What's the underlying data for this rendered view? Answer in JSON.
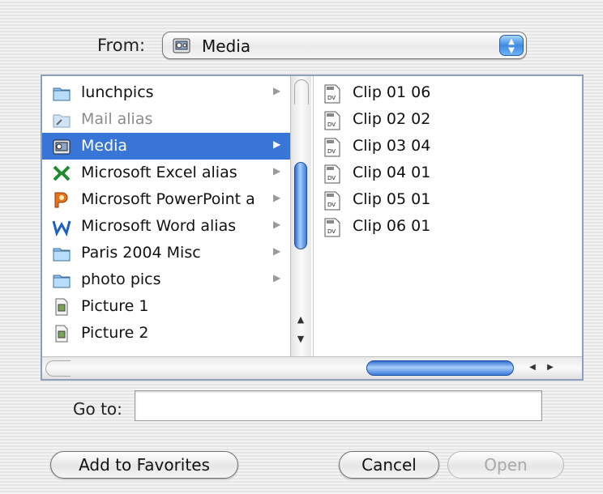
{
  "from": {
    "label": "From:",
    "selected": "Media",
    "icon": "media-folder-icon"
  },
  "left_column": {
    "items": [
      {
        "label": "lunchpics",
        "icon": "folder-icon",
        "arrow": "▶"
      },
      {
        "label": "Mail alias",
        "icon": "alias-icon",
        "dimmed": true
      },
      {
        "label": "Media",
        "icon": "media-folder-icon",
        "arrow": "▶",
        "selected": true
      },
      {
        "label": "Microsoft Excel alias",
        "icon": "excel-icon",
        "arrow": "▶"
      },
      {
        "label": "Microsoft PowerPoint a",
        "icon": "powerpoint-icon",
        "arrow": "▶"
      },
      {
        "label": "Microsoft Word alias",
        "icon": "word-icon",
        "arrow": "▶"
      },
      {
        "label": "Paris 2004 Misc",
        "icon": "folder-icon",
        "arrow": "▶"
      },
      {
        "label": "photo pics",
        "icon": "folder-icon",
        "arrow": "▶"
      },
      {
        "label": "Picture 1",
        "icon": "picture-file-icon"
      },
      {
        "label": "Picture 2",
        "icon": "picture-file-icon"
      }
    ]
  },
  "right_column": {
    "items": [
      {
        "label": "Clip 01 06",
        "icon": "dv-file-icon"
      },
      {
        "label": "Clip 02 02",
        "icon": "dv-file-icon"
      },
      {
        "label": "Clip 03 04",
        "icon": "dv-file-icon"
      },
      {
        "label": "Clip 04 01",
        "icon": "dv-file-icon"
      },
      {
        "label": "Clip 05 01",
        "icon": "dv-file-icon"
      },
      {
        "label": "Clip 06 01",
        "icon": "dv-file-icon"
      }
    ]
  },
  "goto": {
    "label": "Go to:",
    "value": ""
  },
  "buttons": {
    "add_favorites": "Add to Favorites",
    "cancel": "Cancel",
    "open": "Open"
  },
  "colors": {
    "selection": "#3875d7",
    "scroll_accent": "#3b7be0"
  }
}
